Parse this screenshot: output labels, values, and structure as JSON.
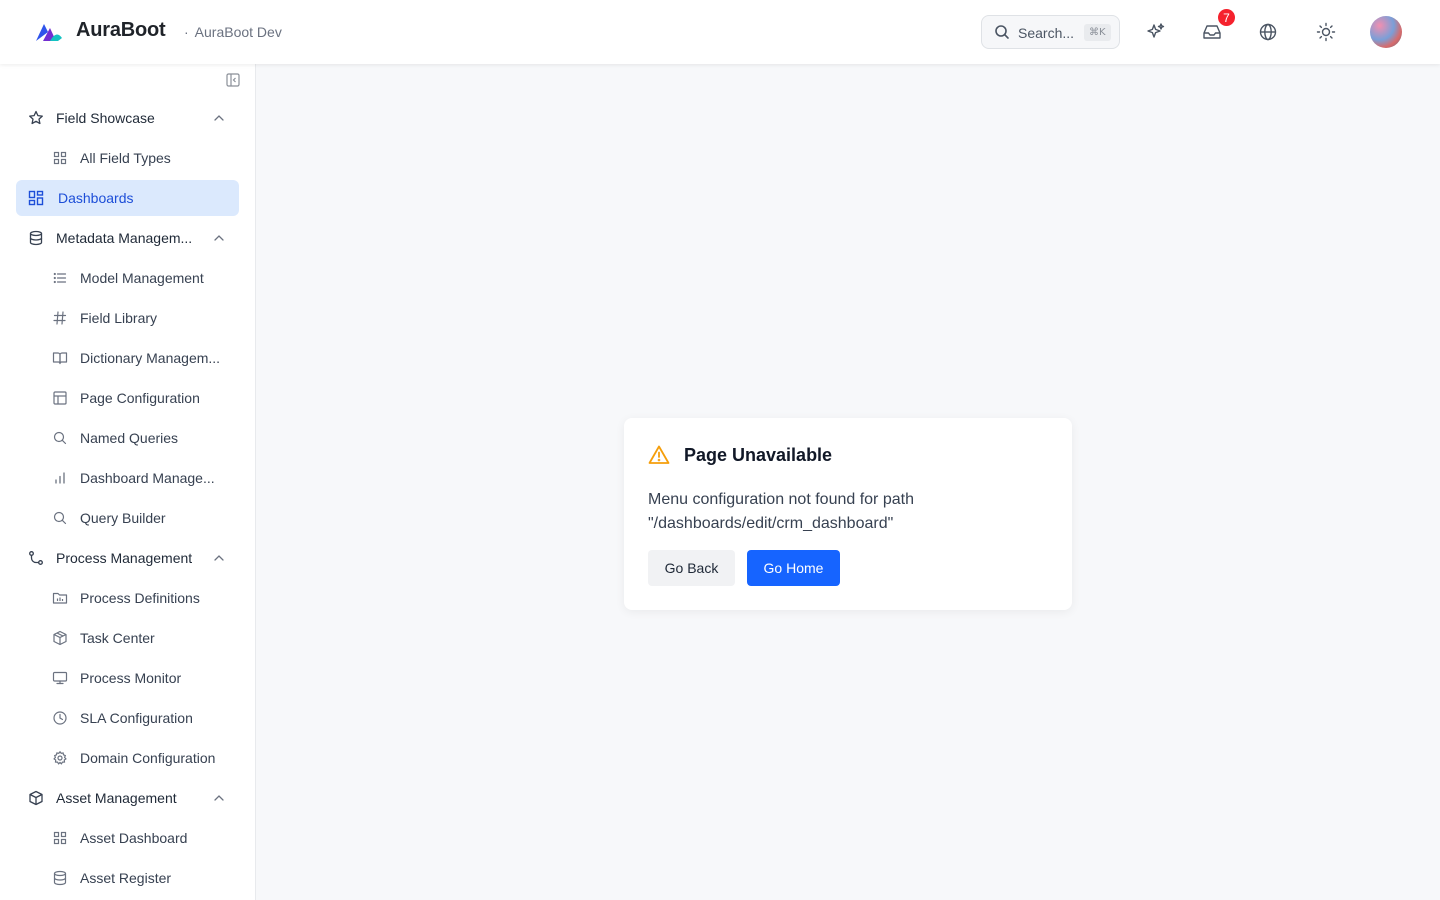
{
  "header": {
    "brand": "AuraBoot",
    "env_dot": "·",
    "env": "AuraBoot Dev",
    "search": {
      "label": "Search...",
      "shortcut": "⌘K"
    },
    "notifications_count": "7"
  },
  "sidebar": {
    "groups": [
      {
        "label": "Field Showcase",
        "icon": "star-icon"
      },
      {
        "label": "Metadata Managem...",
        "icon": "database-icon"
      },
      {
        "label": "Process Management",
        "icon": "git-branch-icon"
      },
      {
        "label": "Asset Management",
        "icon": "box-icon"
      }
    ],
    "items": {
      "all_field_types": "All Field Types",
      "dashboards": "Dashboards",
      "model_management": "Model Management",
      "field_library": "Field Library",
      "dictionary_management": "Dictionary Managem...",
      "page_configuration": "Page Configuration",
      "named_queries": "Named Queries",
      "dashboard_management": "Dashboard Manage...",
      "query_builder": "Query Builder",
      "process_definitions": "Process Definitions",
      "task_center": "Task Center",
      "process_monitor": "Process Monitor",
      "sla_configuration": "SLA Configuration",
      "domain_configuration": "Domain Configuration",
      "asset_dashboard": "Asset Dashboard",
      "asset_register": "Asset Register"
    }
  },
  "error_card": {
    "title": "Page Unavailable",
    "message": "Menu configuration not found for path \"/dashboards/edit/crm_dashboard\"",
    "back_label": "Go Back",
    "home_label": "Go Home"
  },
  "colors": {
    "primary": "#1664ff",
    "active_bg": "#dbe9fd",
    "active_text": "#1d4ed8",
    "warning": "#f59e0b",
    "badge": "#f5222d"
  }
}
